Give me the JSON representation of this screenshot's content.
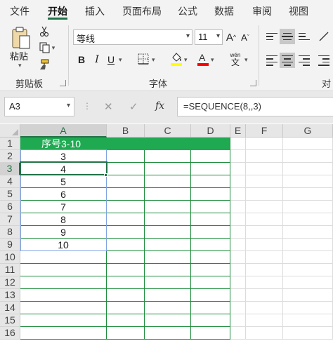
{
  "menu": {
    "tabs": [
      {
        "label": "文件"
      },
      {
        "label": "开始"
      },
      {
        "label": "插入"
      },
      {
        "label": "页面布局"
      },
      {
        "label": "公式"
      },
      {
        "label": "数据"
      },
      {
        "label": "审阅"
      },
      {
        "label": "视图"
      }
    ],
    "active_tab": "开始",
    "accent_color": "#217346"
  },
  "ribbon": {
    "clipboard": {
      "paste_label": "粘贴",
      "group_label": "剪贴板"
    },
    "font": {
      "font_name": "等线",
      "font_size": "11",
      "bold": "B",
      "italic": "I",
      "underline": "U",
      "grow": "A",
      "shrink": "A",
      "font_color_letter": "A",
      "phonetic": "wén",
      "phonetic_char": "文",
      "group_label": "字体",
      "highlight_color": "#ffff00",
      "font_color": "#ff0000"
    },
    "alignment": {
      "group_label": "对"
    }
  },
  "formula_bar": {
    "name_box": "A3",
    "fx": "fx",
    "formula": "=SEQUENCE(8,,3)"
  },
  "sheet": {
    "columns": [
      "A",
      "B",
      "C",
      "D",
      "E",
      "F",
      "G"
    ],
    "rows": [
      "1",
      "2",
      "3",
      "4",
      "5",
      "6",
      "7",
      "8",
      "9",
      "10",
      "11",
      "12",
      "13",
      "14",
      "15",
      "16"
    ],
    "selected_cell": "A3",
    "header_cell": "序号3-10",
    "values": [
      "3",
      "4",
      "5",
      "6",
      "7",
      "8",
      "9",
      "10"
    ],
    "header_fill": "#1faa52",
    "grid_border_color": "#1e8c3c"
  }
}
